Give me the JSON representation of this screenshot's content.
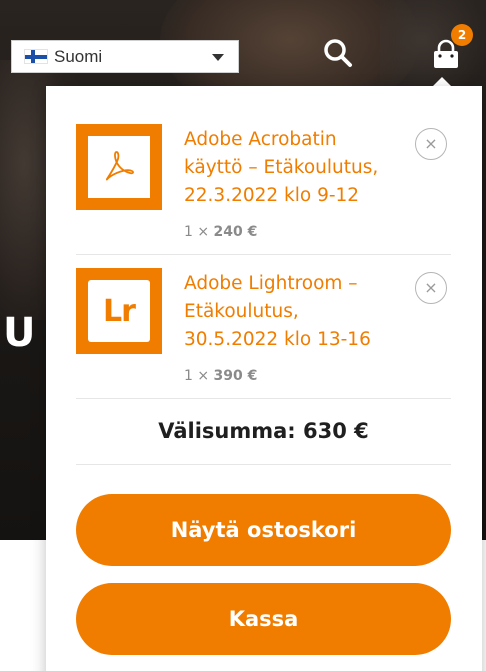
{
  "header": {
    "language": {
      "selected": "Suomi"
    },
    "cart_count": "2",
    "hero_text": "U"
  },
  "cart": {
    "items": [
      {
        "title": "Adobe Acrobatin\nkäyttö – Etäkoulutus,\n22.3.2022 klo 9-12",
        "qty": "1 ×",
        "price": "240 €",
        "remove": "×"
      },
      {
        "title": "Adobe Lightroom –\nEtäkoulutus,\n30.5.2022 klo 13-16",
        "qty": "1 ×",
        "price": "390 €",
        "remove": "×",
        "thumb_text": "Lr"
      }
    ],
    "subtotal": "Välisumma: 630 €",
    "view_cart_label": "Näytä ostoskori",
    "checkout_label": "Kassa"
  },
  "colors": {
    "accent": "#f07d00",
    "hero_bg": "#1d1a18"
  }
}
